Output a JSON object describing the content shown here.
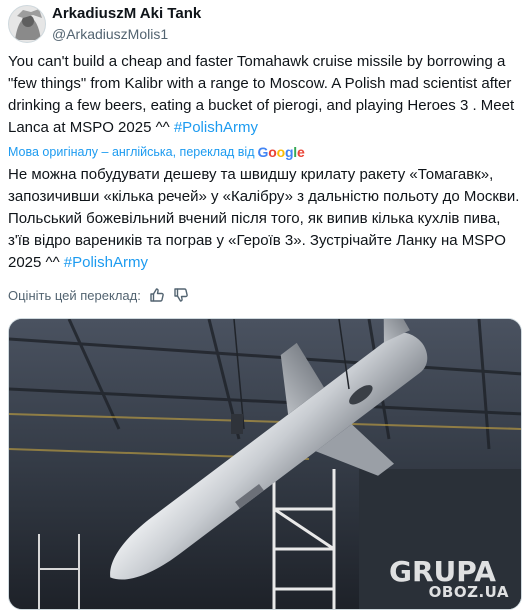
{
  "author": {
    "display_name": "ArkadiuszM Aki Tank",
    "handle": "@ArkadiuszMolis1",
    "avatar_icon": "avatar-icon"
  },
  "post": {
    "text_en": "You can't build a cheap and faster Tomahawk cruise missile by borrowing a \"few things\" from Kalibr with a range to Moscow. A Polish mad scientist after drinking a few beers, eating a bucket of pierogi, and playing Heroes 3 . Meet Lanca at MSPO 2025 ^^ ",
    "hashtag_en": "#PolishArmy",
    "translation_note": "Мова оригіналу – англійська, переклад від",
    "google_logo": [
      "G",
      "o",
      "o",
      "g",
      "l",
      "e"
    ],
    "text_uk": "Не можна побудувати дешеву та швидшу крилату ракету «Томагавк», запозичивши «кілька речей» у «Калібру» з дальністю польоту до Москви. Польський божевільний вчений після того, як випив кілька кухлів пива, з'їв відро вареників та пограв у «Героїв 3». Зустрічайте Ланку на MSPO 2025 ^^ ",
    "hashtag_uk": "#PolishArmy",
    "rate_label": "Оцініть цей переклад:"
  },
  "media": {
    "watermark": "OBOZ.UA",
    "banner_text": "GRUPA"
  },
  "colors": {
    "link": "#1d9bf0",
    "text": "#0f1419",
    "muted": "#536471"
  }
}
